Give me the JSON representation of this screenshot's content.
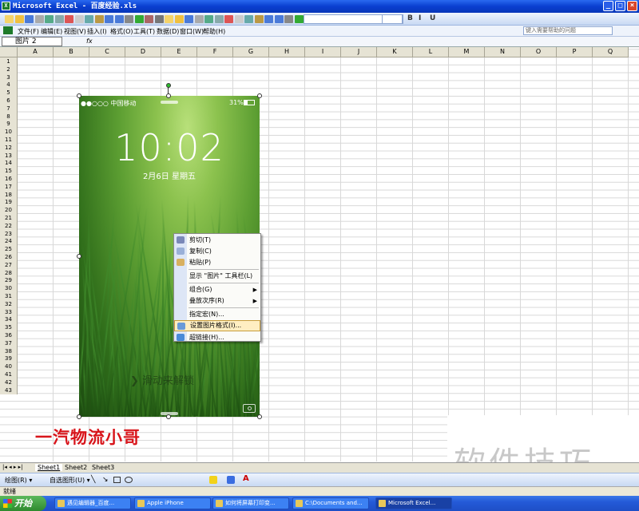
{
  "window": {
    "title": "Microsoft Excel - 百度经验.xls",
    "min": "_",
    "max": "□",
    "close": "×"
  },
  "menu": {
    "items": [
      "文件(F)",
      "编辑(E)",
      "视图(V)",
      "插入(I)",
      "格式(O)",
      "工具(T)",
      "数据(D)",
      "窗口(W)",
      "帮助(H)"
    ],
    "help_placeholder": "键入需要帮助的问题"
  },
  "formula": {
    "name_box": "图片 2",
    "fx": "fx"
  },
  "columns": [
    "A",
    "B",
    "C",
    "D",
    "E",
    "F",
    "G",
    "H",
    "I",
    "J",
    "K",
    "L",
    "M",
    "N",
    "O",
    "P",
    "Q"
  ],
  "row_count": 43,
  "phone": {
    "carrier": "●●○○○ 中国移动",
    "battery": "31%",
    "time": "10:02",
    "date": "2月6日 星期五",
    "unlock": "滑动来解锁"
  },
  "context_menu": {
    "items": [
      {
        "label": "剪切(T)",
        "icon": "scissors-icon"
      },
      {
        "label": "复制(C)",
        "icon": "copy-icon"
      },
      {
        "label": "粘贴(P)",
        "icon": "paste-icon"
      },
      {
        "label": "显示 \"图片\" 工具栏(L)",
        "icon": ""
      },
      {
        "label": "组合(G)",
        "icon": "",
        "submenu": true
      },
      {
        "label": "叠放次序(R)",
        "icon": "",
        "submenu": true
      },
      {
        "label": "指定宏(N)...",
        "icon": ""
      },
      {
        "label": "设置图片格式(I)...",
        "icon": "format-icon",
        "highlighted": true
      },
      {
        "label": "超链接(H)...",
        "icon": "hyperlink-icon"
      }
    ]
  },
  "watermark_red": "一汽物流小哥",
  "watermark_gray": "软件技巧",
  "sheets": [
    "Sheet1",
    "Sheet2",
    "Sheet3"
  ],
  "drawing": {
    "draw": "绘图(R) ▾",
    "autoshapes": "自选图形(U) ▾"
  },
  "status": "就绪",
  "taskbar": {
    "start": "开始",
    "tasks": [
      "遇见编辑器_百度...",
      "Apple iPhone",
      "如何将屏幕打印变...",
      "C:\\Documents and...",
      "Microsoft Excel..."
    ]
  }
}
